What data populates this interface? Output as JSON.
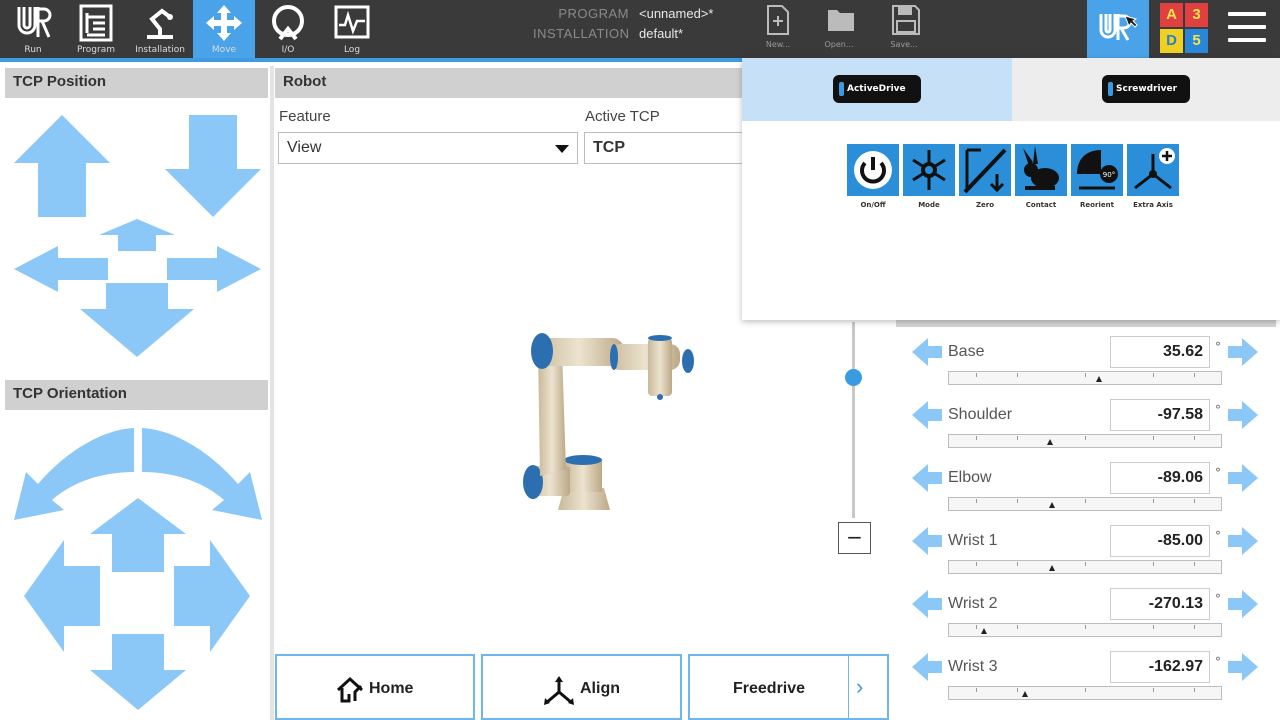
{
  "nav": {
    "tabs": [
      {
        "label": "Run",
        "icon": "run-icon"
      },
      {
        "label": "Program",
        "icon": "program-icon"
      },
      {
        "label": "Installation",
        "icon": "installation-icon"
      },
      {
        "label": "Move",
        "icon": "move-icon",
        "active": true
      },
      {
        "label": "I/O",
        "icon": "io-icon"
      },
      {
        "label": "Log",
        "icon": "log-icon"
      }
    ]
  },
  "program_info": {
    "program_key": "PROGRAM",
    "program_value": "<unnamed>*",
    "installation_key": "INSTALLATION",
    "installation_value": "default*"
  },
  "file_buttons": [
    {
      "label": "New...",
      "icon": "new-file-icon"
    },
    {
      "label": "Open...",
      "icon": "open-folder-icon"
    },
    {
      "label": "Save...",
      "icon": "save-icon"
    }
  ],
  "ad_indicator": {
    "cells": [
      "A",
      "3",
      "D",
      "5"
    ]
  },
  "tcp_position": {
    "title": "TCP Position"
  },
  "tcp_orientation": {
    "title": "TCP Orientation"
  },
  "robot": {
    "title": "Robot",
    "feature_label": "Feature",
    "feature_value": "View",
    "active_tcp_label": "Active TCP",
    "active_tcp_value": "TCP",
    "zoom_out_symbol": "−"
  },
  "actions": {
    "home": "Home",
    "align": "Align",
    "freedrive": "Freedrive",
    "more_symbol": "›"
  },
  "overlay": {
    "tabs": [
      "ActiveDrive",
      "Screwdriver"
    ],
    "tools": [
      {
        "label": "On/Off",
        "icon": "power-icon"
      },
      {
        "label": "Mode",
        "icon": "mode-icon"
      },
      {
        "label": "Zero",
        "icon": "zero-icon"
      },
      {
        "label": "Contact",
        "icon": "rabbit-icon"
      },
      {
        "label": "Reorient",
        "icon": "reorient-icon"
      },
      {
        "label": "Extra Axis",
        "icon": "extra-axis-icon"
      }
    ]
  },
  "joints": [
    {
      "name": "Base",
      "value": "35.62",
      "unit": "°",
      "position_fraction": 0.55
    },
    {
      "name": "Shoulder",
      "value": "-97.58",
      "unit": "°",
      "position_fraction": 0.37
    },
    {
      "name": "Elbow",
      "value": "-89.06",
      "unit": "°",
      "position_fraction": 0.38
    },
    {
      "name": "Wrist 1",
      "value": "-85.00",
      "unit": "°",
      "position_fraction": 0.38
    },
    {
      "name": "Wrist 2",
      "value": "-270.13",
      "unit": "°",
      "position_fraction": 0.13
    },
    {
      "name": "Wrist 3",
      "value": "-162.97",
      "unit": "°",
      "position_fraction": 0.28
    }
  ],
  "colors": {
    "accent": "#4aa3e8",
    "arrow": "#8cc8f7",
    "topbar": "#3a3a3a"
  }
}
